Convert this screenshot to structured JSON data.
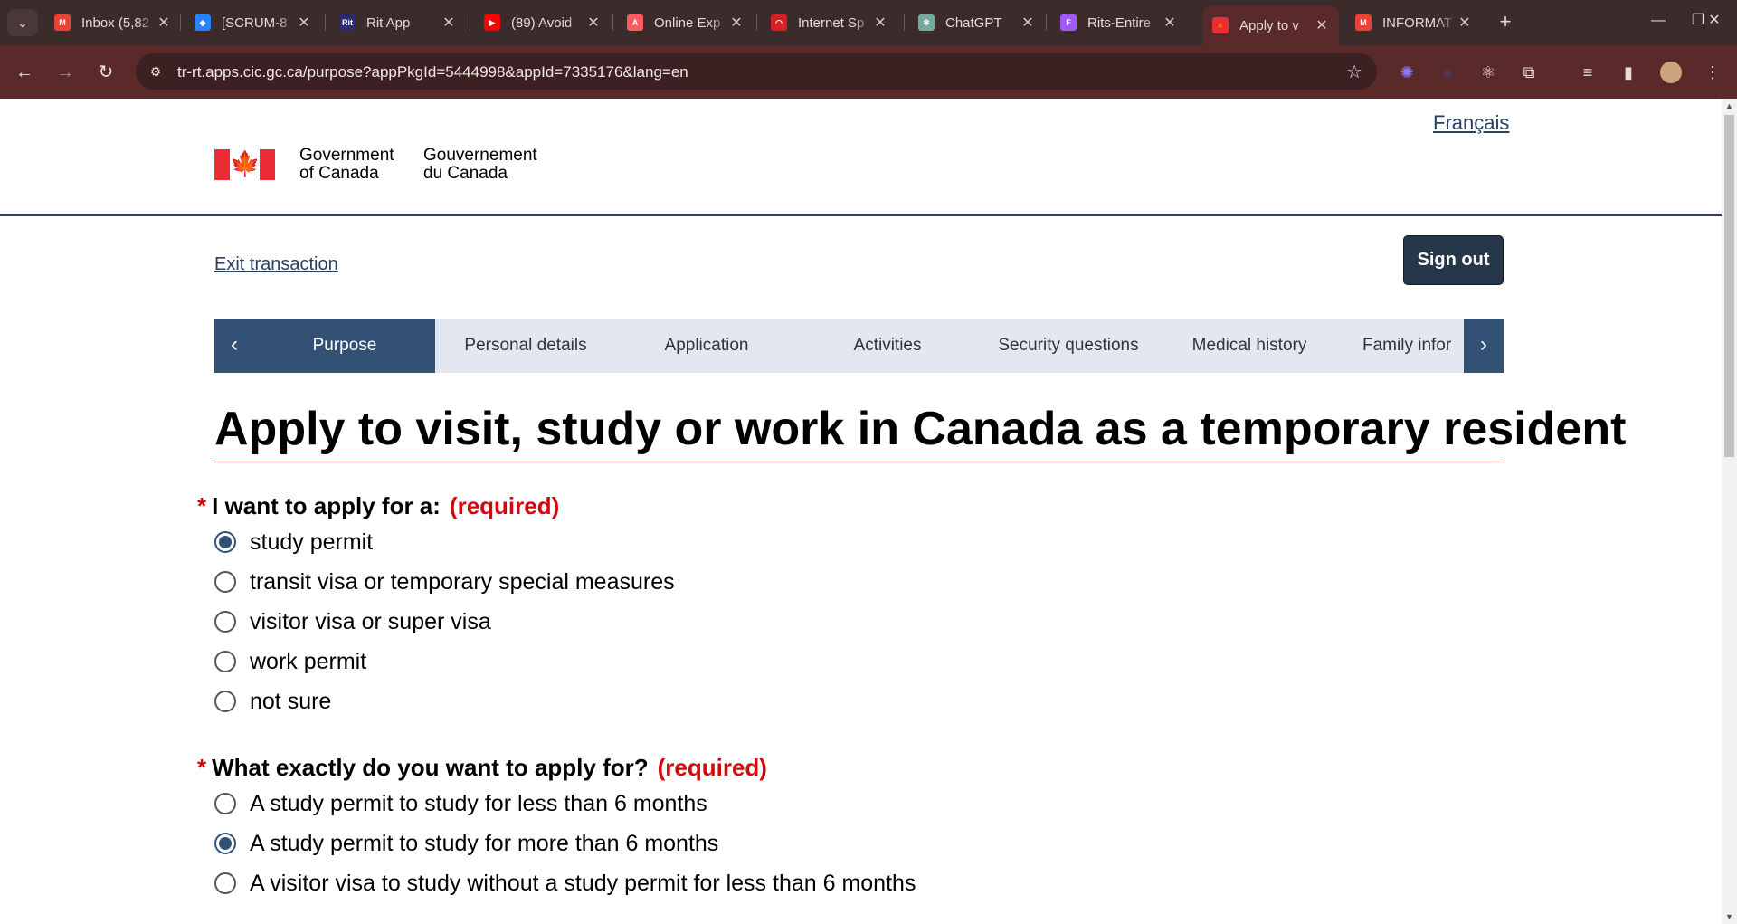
{
  "browser": {
    "tabs": [
      {
        "title": "Inbox (5,82",
        "icon": "gmail-icon",
        "color": "#ea4335",
        "glyph": "M",
        "active": false
      },
      {
        "title": "[SCRUM-8",
        "icon": "jira-icon",
        "color": "#2684ff",
        "glyph": "◆",
        "active": false
      },
      {
        "title": "Rit App",
        "icon": "rit-app-icon",
        "color": "#2b2b6e",
        "glyph": "Rit",
        "active": false
      },
      {
        "title": "(89) Avoid",
        "icon": "youtube-icon",
        "color": "#ff0000",
        "glyph": "▶",
        "active": false
      },
      {
        "title": "Online Exp",
        "icon": "airbnb-icon",
        "color": "#ff5a5f",
        "glyph": "A",
        "active": false
      },
      {
        "title": "Internet Sp",
        "icon": "speedtest-icon",
        "color": "#d91f26",
        "glyph": "◠",
        "active": false
      },
      {
        "title": "ChatGPT",
        "icon": "chatgpt-icon",
        "color": "#74aa9c",
        "glyph": "✻",
        "active": false
      },
      {
        "title": "Rits-Entire",
        "icon": "figma-icon",
        "color": "#a259ff",
        "glyph": "F",
        "active": false
      },
      {
        "title": "Apply to v",
        "icon": "maple-leaf-icon",
        "color": "#eb2d37",
        "glyph": "🍁",
        "active": true
      },
      {
        "title": "INFORMAT",
        "icon": "gmail-icon",
        "color": "#ea4335",
        "glyph": "M",
        "active": false
      }
    ],
    "url": "tr-rt.apps.cic.gc.ca/purpose?appPkgId=5444998&appId=7335176&lang=en"
  },
  "header": {
    "language_link": "Français",
    "gov_en_line1": "Government",
    "gov_en_line2": "of Canada",
    "gov_fr_line1": "Gouvernement",
    "gov_fr_line2": "du Canada"
  },
  "actions": {
    "exit_label": "Exit transaction",
    "signout_label": "Sign out"
  },
  "stepper": {
    "steps": [
      "Purpose",
      "Personal details",
      "Application",
      "Activities",
      "Security questions",
      "Medical history",
      "Family infor"
    ],
    "active_index": 0
  },
  "page_title": "Apply to visit, study or work in Canada as a temporary resident",
  "questions": [
    {
      "label": "I want to apply for a:",
      "required_text": "(required)",
      "options": [
        "study permit",
        "transit visa or temporary special measures",
        "visitor visa or super visa",
        "work permit",
        "not sure"
      ],
      "selected_index": 0
    },
    {
      "label": "What exactly do you want to apply for?",
      "required_text": "(required)",
      "options": [
        "A study permit to study for less than 6 months",
        "A study permit to study for more than 6 months",
        "A visitor visa to study without a study permit for less than 6 months"
      ],
      "selected_index": 1
    }
  ]
}
